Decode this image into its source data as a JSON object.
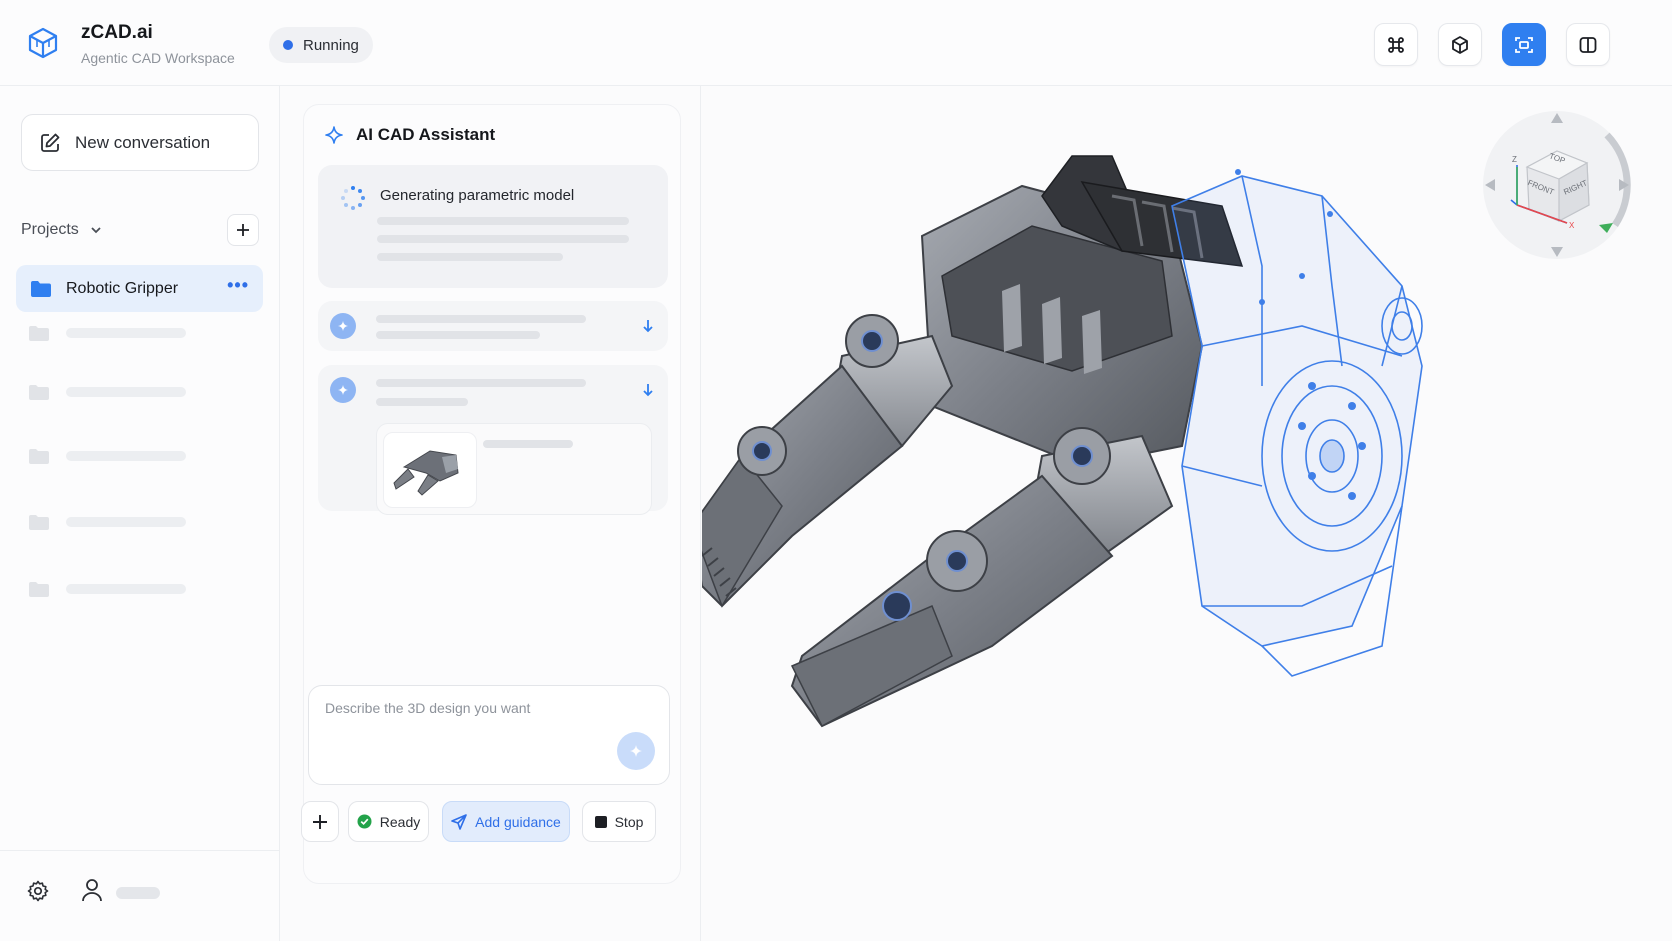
{
  "app": {
    "title": "zCAD.ai",
    "subtitle": "Agentic CAD Workspace",
    "status": "Running",
    "accent_color": "#2f7ff0"
  },
  "toolbar": {
    "buttons": [
      {
        "icon": "command-icon",
        "active": false
      },
      {
        "icon": "cube-icon",
        "active": false
      },
      {
        "icon": "scan-focus-icon",
        "active": true
      },
      {
        "icon": "split-panel-icon",
        "active": false
      }
    ]
  },
  "sidebar": {
    "new_conversation_label": "New conversation",
    "projects_label": "Projects",
    "active_project": "Robotic Gripper",
    "more_label": "•••"
  },
  "assistant": {
    "title": "AI CAD Assistant",
    "generating_label": "Generating parametric model",
    "input_placeholder": "Describe the 3D design you want"
  },
  "actions": {
    "ready_label": "Ready",
    "add_guidance_label": "Add guidance",
    "stop_label": "Stop"
  },
  "viewcube": {
    "top_label": "TOP",
    "front_label": "FRONT",
    "right_label": "RIGHT",
    "axis_z": "Z",
    "axis_x": "X"
  }
}
